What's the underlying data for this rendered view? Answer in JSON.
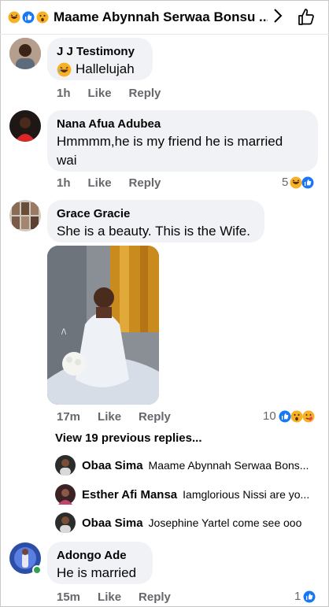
{
  "header": {
    "title": "Maame Abynnah Serwaa Bonsu ...",
    "reactions": [
      "haha-emoji",
      "like-emoji",
      "wow-emoji"
    ],
    "chevron": "chevron-right-icon",
    "like_icon": "thumbs-up-icon"
  },
  "comments": [
    {
      "name": "J J Testimony",
      "text": "Hallelujah",
      "time": "1h",
      "like_label": "Like",
      "reply_label": "Reply"
    },
    {
      "name": "Nana Afua Adubea",
      "text_line1": "Hmmmm,he is my friend he is married",
      "text_line2": "wai",
      "time": "1h",
      "like_label": "Like",
      "reply_label": "Reply",
      "reaction_count": "5"
    },
    {
      "name": "Grace Gracie",
      "text": "She is a beauty. This is the Wife.",
      "time": "17m",
      "like_label": "Like",
      "reply_label": "Reply",
      "reaction_count": "10"
    },
    {
      "name": "Adongo Ade",
      "text": "He is married",
      "time": "15m",
      "like_label": "Like",
      "reply_label": "Reply",
      "reaction_count": "1"
    }
  ],
  "replies": {
    "view_previous": "View 19 previous replies...",
    "items": [
      {
        "name": "Obaa Sima",
        "text": "Maame Abynnah Serwaa Bons..."
      },
      {
        "name": "Esther Afi Mansa",
        "text": "Iamglorious Nissi are yo..."
      },
      {
        "name": "Obaa Sima",
        "text": "Josephine Yartel come see ooo"
      }
    ]
  },
  "colors": {
    "like_blue": "#1877f2",
    "emoji_yellow": "#f7b125",
    "bubble_gray": "#f0f2f5",
    "meta_gray": "#65676b"
  }
}
